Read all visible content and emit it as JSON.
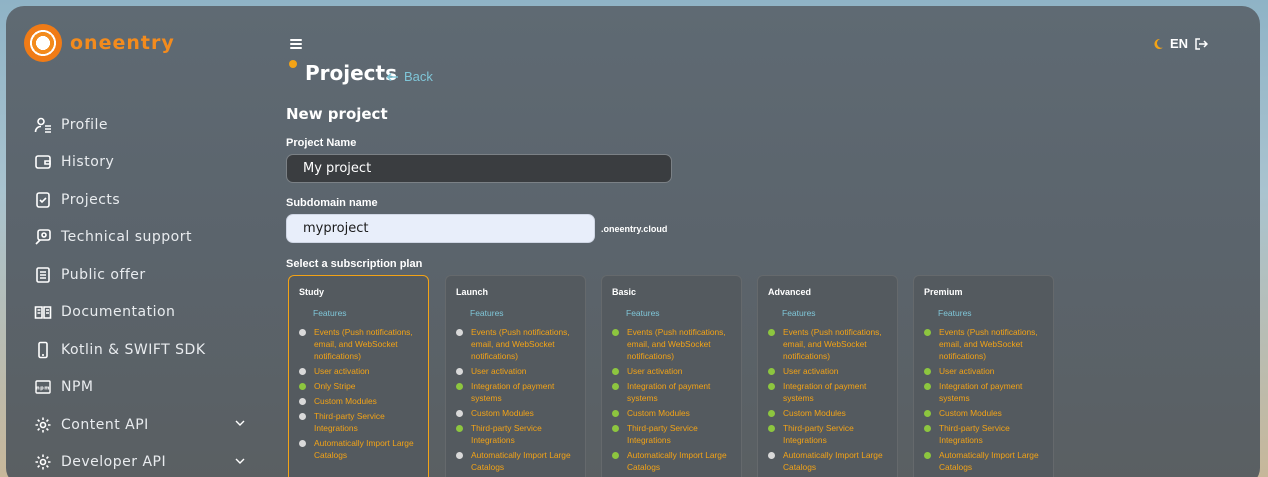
{
  "brand": {
    "name": "oneentry",
    "color": "#f38b1d"
  },
  "sidebar": {
    "items": [
      {
        "label": "Profile",
        "icon": "user-icon",
        "expandable": false
      },
      {
        "label": "History",
        "icon": "wallet-icon",
        "expandable": false
      },
      {
        "label": "Projects",
        "icon": "projects-icon",
        "expandable": false
      },
      {
        "label": "Technical support",
        "icon": "support-icon",
        "expandable": false
      },
      {
        "label": "Public offer",
        "icon": "document-icon",
        "expandable": false
      },
      {
        "label": "Documentation",
        "icon": "book-icon",
        "expandable": false
      },
      {
        "label": "Kotlin & SWIFT SDK",
        "icon": "mobile-icon",
        "expandable": false
      },
      {
        "label": "NPM",
        "icon": "npm-icon",
        "expandable": false
      },
      {
        "label": "Content API",
        "icon": "gear-icon",
        "expandable": true
      },
      {
        "label": "Developer API",
        "icon": "gear-icon",
        "expandable": true
      }
    ]
  },
  "header": {
    "title": "Projects",
    "back_label": "Back",
    "language": "EN",
    "theme_icon": "moon-icon",
    "logout_icon": "logout-icon"
  },
  "form": {
    "heading": "New project",
    "project_name_label": "Project Name",
    "project_name_value": "My project",
    "subdomain_label": "Subdomain name",
    "subdomain_value": "myproject",
    "subdomain_suffix": ".oneentry.cloud",
    "plan_label": "Select a subscription plan"
  },
  "plans": [
    {
      "name": "Study",
      "selected": true,
      "features_label": "Features",
      "features": [
        {
          "text": "Events (Push notifications, email, and WebSocket notifications)",
          "included": false
        },
        {
          "text": "User activation",
          "included": false
        },
        {
          "text": "Only Stripe",
          "included": true
        },
        {
          "text": "Custom Modules",
          "included": false
        },
        {
          "text": "Third-party Service Integrations",
          "included": false
        },
        {
          "text": "Automatically Import Large Catalogs",
          "included": false
        }
      ]
    },
    {
      "name": "Launch",
      "selected": false,
      "features_label": "Features",
      "features": [
        {
          "text": "Events (Push notifications, email, and WebSocket notifications)",
          "included": false
        },
        {
          "text": "User activation",
          "included": false
        },
        {
          "text": "Integration of payment systems",
          "included": true
        },
        {
          "text": "Custom Modules",
          "included": false
        },
        {
          "text": "Third-party Service Integrations",
          "included": true
        },
        {
          "text": "Automatically Import Large Catalogs",
          "included": false
        }
      ]
    },
    {
      "name": "Basic",
      "selected": false,
      "features_label": "Features",
      "features": [
        {
          "text": "Events (Push notifications, email, and WebSocket notifications)",
          "included": true
        },
        {
          "text": "User activation",
          "included": true
        },
        {
          "text": "Integration of payment systems",
          "included": true
        },
        {
          "text": "Custom Modules",
          "included": true
        },
        {
          "text": "Third-party Service Integrations",
          "included": true
        },
        {
          "text": "Automatically Import Large Catalogs",
          "included": true
        }
      ]
    },
    {
      "name": "Advanced",
      "selected": false,
      "features_label": "Features",
      "features": [
        {
          "text": "Events (Push notifications, email, and WebSocket notifications)",
          "included": true
        },
        {
          "text": "User activation",
          "included": true
        },
        {
          "text": "Integration of payment systems",
          "included": true
        },
        {
          "text": "Custom Modules",
          "included": true
        },
        {
          "text": "Third-party Service Integrations",
          "included": true
        },
        {
          "text": "Automatically Import Large Catalogs",
          "included": false
        }
      ]
    },
    {
      "name": "Premium",
      "selected": false,
      "features_label": "Features",
      "features": [
        {
          "text": "Events (Push notifications, email, and WebSocket notifications)",
          "included": true
        },
        {
          "text": "User activation",
          "included": true
        },
        {
          "text": "Integration of payment systems",
          "included": true
        },
        {
          "text": "Custom Modules",
          "included": true
        },
        {
          "text": "Third-party Service Integrations",
          "included": true
        },
        {
          "text": "Automatically Import Large Catalogs",
          "included": true
        }
      ]
    }
  ]
}
